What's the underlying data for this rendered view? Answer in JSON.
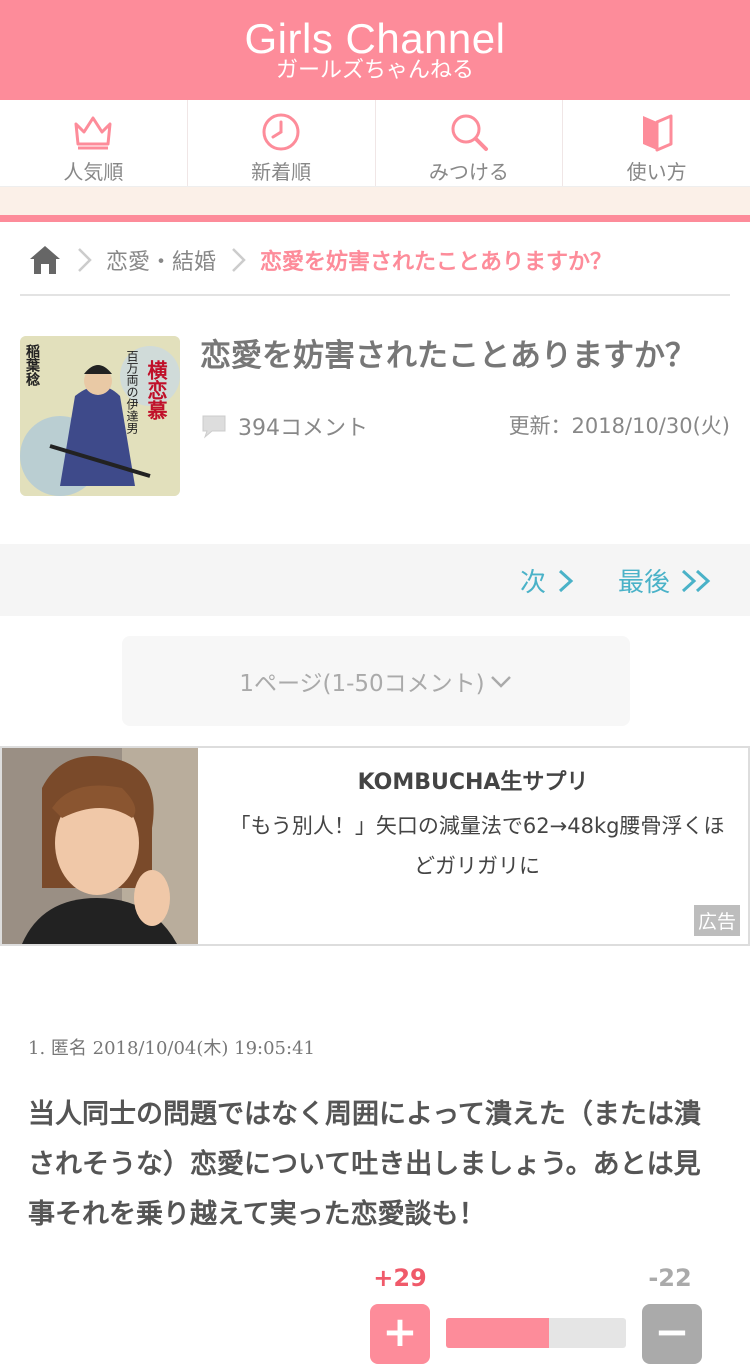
{
  "header": {
    "logo_en": "Girls Channel",
    "logo_ja": "ガールズちゃんねる",
    "color": "#fd8c9a"
  },
  "nav": [
    {
      "label": "人気順",
      "icon": "crown-icon"
    },
    {
      "label": "新着順",
      "icon": "clock-icon"
    },
    {
      "label": "みつける",
      "icon": "search-icon"
    },
    {
      "label": "使い方",
      "icon": "book-icon"
    }
  ],
  "breadcrumb": {
    "category": "恋愛・結婚",
    "current": "恋愛を妨害されたことありますか？"
  },
  "topic": {
    "title": "恋愛を妨害されたことありますか？",
    "comment_count": "394コメント",
    "updated": "更新：2018/10/30(火)",
    "thumbnail": {
      "author": "稲葉稔",
      "series": "百万両の伊達男",
      "book_title": "横恋慕"
    }
  },
  "pager": {
    "next": "次",
    "last": "最後",
    "select": "1ページ(1-50コメント)"
  },
  "ad": {
    "title": "KOMBUCHA生サプリ",
    "body": "「もう別人！」矢口の減量法で62→48kg腰骨浮くほどガリガリに",
    "badge": "広告"
  },
  "comment": {
    "meta": "1. 匿名 2018/10/04(木) 19:05:41",
    "body": "当人同士の問題ではなく周囲によって潰えた（または潰されそうな）恋愛について吐き出しましょう。あとは見事それを乗り越えて実った恋愛談も！",
    "plus": "+29",
    "minus": "-22",
    "plus_ratio": 0.57,
    "plus_symbol": "+",
    "minus_symbol": "−"
  }
}
